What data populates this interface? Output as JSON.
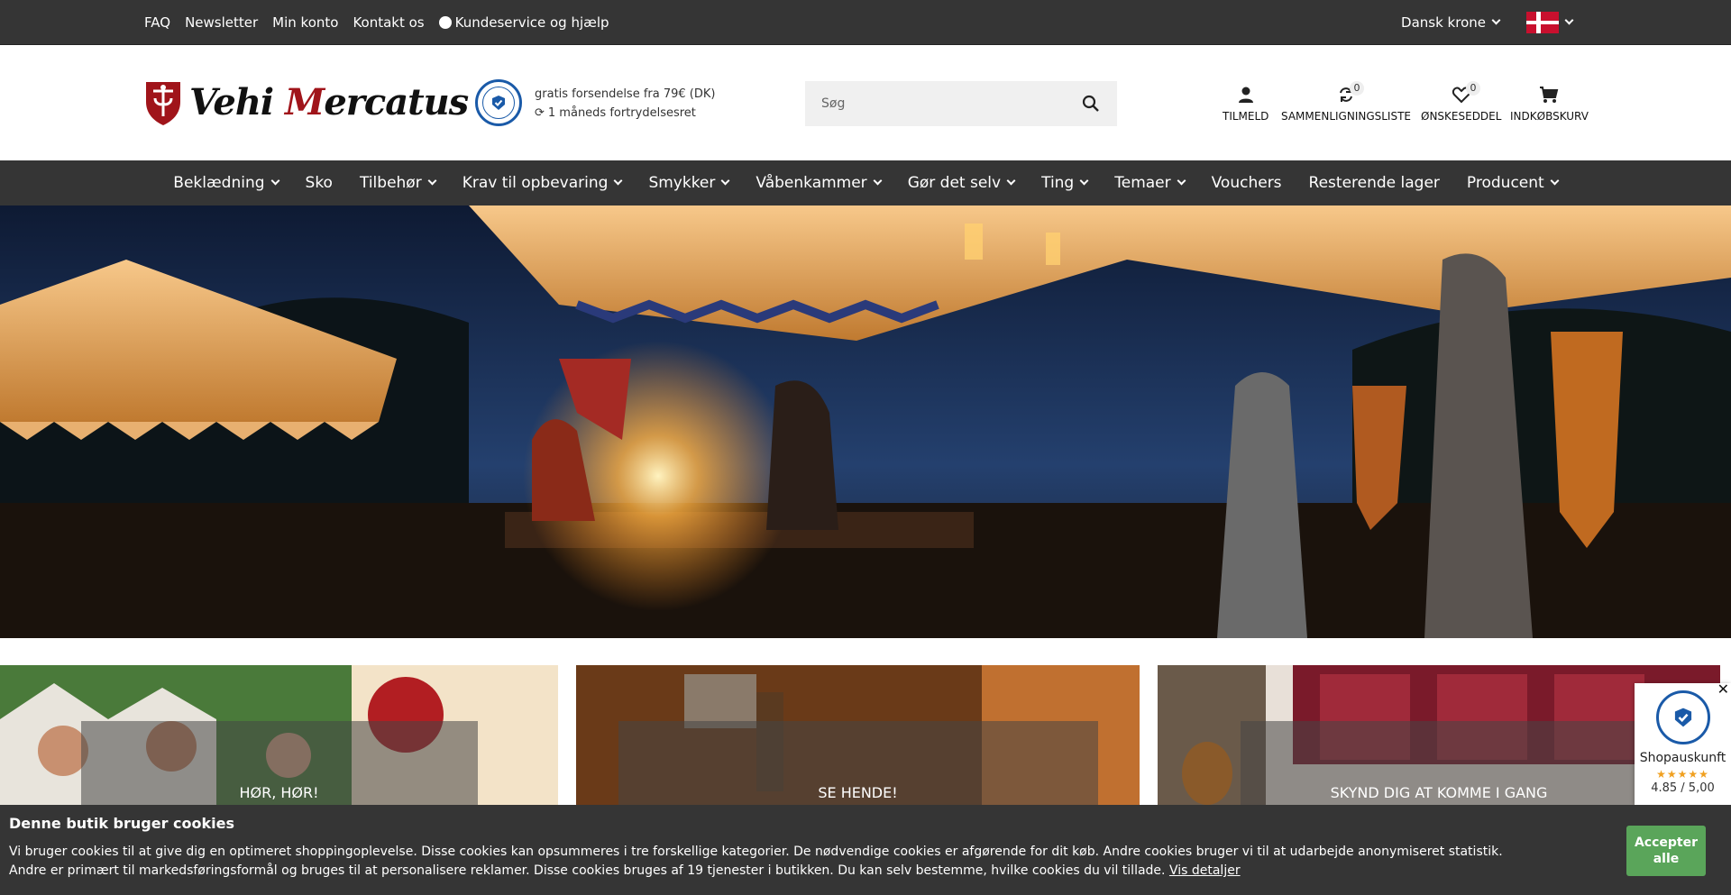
{
  "topbar": {
    "links": [
      "FAQ",
      "Newsletter",
      "Min konto",
      "Kontakt os"
    ],
    "service_label": "Kundeservice og hjælp",
    "currency": "Dansk krone",
    "language_flag": "denmark-flag"
  },
  "header": {
    "logo_text_prefix": "V",
    "logo_text_mid": "ehi ",
    "logo_text_m": "M",
    "logo_text_suffix": "ercatus",
    "shipping_line1": "gratis forsendelse fra 79€ (DK)",
    "shipping_line2": "1 måneds fortrydelsesret",
    "search_placeholder": "Søg",
    "actions": {
      "login": "TILMELD",
      "compare": "SAMMENLIGNINGSLISTE",
      "compare_count": "0",
      "wishlist": "ØNSKESEDDEL",
      "wishlist_count": "0",
      "cart": "INDKØBSKURV"
    }
  },
  "nav": {
    "items": [
      {
        "label": "Beklædning",
        "dropdown": true
      },
      {
        "label": "Sko",
        "dropdown": false
      },
      {
        "label": "Tilbehør",
        "dropdown": true
      },
      {
        "label": "Krav til opbevaring",
        "dropdown": true
      },
      {
        "label": "Smykker",
        "dropdown": true
      },
      {
        "label": "Våbenkammer",
        "dropdown": true
      },
      {
        "label": "Gør det selv",
        "dropdown": true
      },
      {
        "label": "Ting",
        "dropdown": true
      },
      {
        "label": "Temaer",
        "dropdown": true
      },
      {
        "label": "Vouchers",
        "dropdown": false
      },
      {
        "label": "Resterende lager",
        "dropdown": false
      },
      {
        "label": "Producent",
        "dropdown": true
      }
    ]
  },
  "tiles": [
    {
      "label": "HØR, HØR!"
    },
    {
      "label": "SE HENDE!"
    },
    {
      "label": "SKYND DIG AT KOMME I GANG"
    }
  ],
  "cookie": {
    "title": "Denne butik bruger cookies",
    "text": "Vi bruger cookies til at give dig en optimeret shoppingoplevelse. Disse cookies kan opsummeres i tre forskellige kategorier. De nødvendige cookies er afgørende for dit køb. Andre cookies bruger vi til at udarbejde anonymiseret statistik. Andre er primært til markedsføringsformål og bruges til at personalisere reklamer. Disse cookies bruges af 19 tjenester i butikken. Du kan selv bestemme, hvilke cookies du vil tillade.",
    "details_link": "Vis detaljer",
    "accept_line1": "Accepter",
    "accept_line2": "alle"
  },
  "rating": {
    "name": "Shopauskunft",
    "stars": "★★★★★",
    "score": "4.85 / 5,00"
  },
  "colors": {
    "dark_bar": "#353535",
    "brand_red": "#a0141a",
    "badge_blue": "#1a5aa8",
    "accept_green": "#5aa55a"
  }
}
